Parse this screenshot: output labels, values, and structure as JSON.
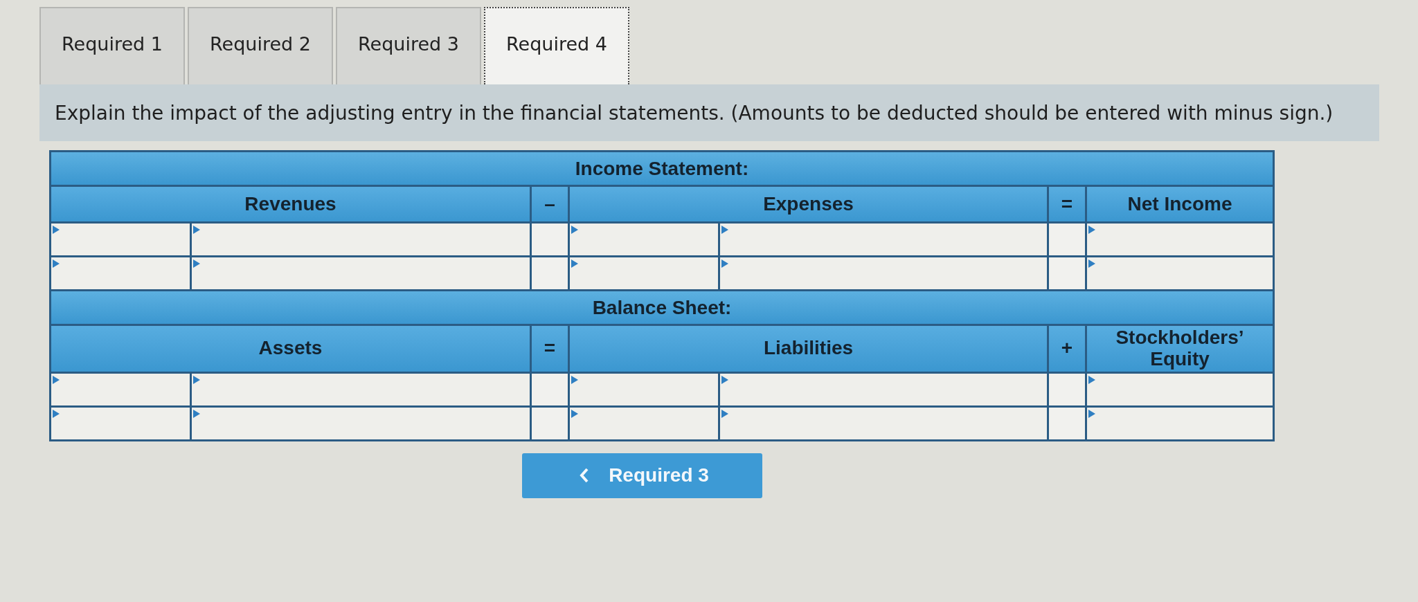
{
  "tabs": [
    {
      "label": "Required 1",
      "selected": false
    },
    {
      "label": "Required 2",
      "selected": false
    },
    {
      "label": "Required 3",
      "selected": false
    },
    {
      "label": "Required 4",
      "selected": true
    }
  ],
  "instruction": "Explain the impact of the adjusting entry in the financial statements. (Amounts to be deducted should be entered with minus sign.)",
  "sections": [
    {
      "title": "Income Statement:",
      "columns": [
        {
          "kind": "pair",
          "label": "Revenues"
        },
        {
          "kind": "operator",
          "label": "–"
        },
        {
          "kind": "pair",
          "label": "Expenses"
        },
        {
          "kind": "operator",
          "label": "="
        },
        {
          "kind": "single",
          "label": "Net Income"
        }
      ],
      "rows": [
        {
          "kind": "entry"
        },
        {
          "kind": "entry"
        }
      ]
    },
    {
      "title": "Balance Sheet:",
      "columns": [
        {
          "kind": "pair",
          "label": "Assets"
        },
        {
          "kind": "operator",
          "label": "="
        },
        {
          "kind": "pair",
          "label": "Liabilities"
        },
        {
          "kind": "operator",
          "label": "+"
        },
        {
          "kind": "single",
          "label": "Stockholders’ Equity"
        }
      ],
      "rows": [
        {
          "kind": "entry"
        },
        {
          "kind": "entry"
        }
      ]
    }
  ],
  "nav_button": {
    "label": "Required 3"
  }
}
